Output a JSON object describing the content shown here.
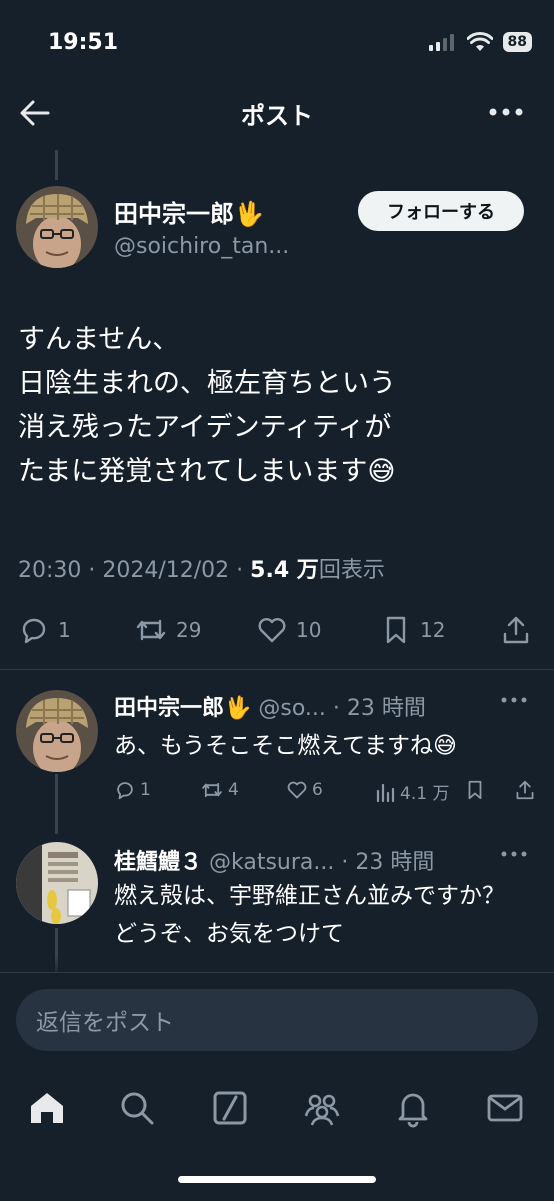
{
  "status_bar": {
    "time": "19:51",
    "battery": "88"
  },
  "header": {
    "title": "ポスト"
  },
  "post": {
    "author_name": "田中宗一郎🖖",
    "author_handle": "@soichiro_tan...",
    "follow_label": "フォローする",
    "body": "すんません、\n日陰生まれの、極左育ちという\n消え残ったアイデンティティが\nたまに発覚されてしまいます😅",
    "time": "20:30 · 2024/12/02 · ",
    "views_count": "5.4 万",
    "views_label": "回表示",
    "stats": {
      "replies": "1",
      "reposts": "29",
      "likes": "10",
      "bookmarks": "12"
    }
  },
  "replies": [
    {
      "name": "田中宗一郎🖖",
      "handle_time": " @so... · 23 時間",
      "text": "あ、もうそこそこ燃えてますね😅",
      "stats": {
        "replies": "1",
        "reposts": "4",
        "likes": "6",
        "views": "4.1 万"
      }
    },
    {
      "name": "桂鱈鱧３",
      "handle_time": " @katsura... · 23 時間",
      "text": "燃え殻は、宇野維正さん並みですか？\nどうぞ、お気をつけて"
    }
  ],
  "reply_input": {
    "placeholder": "返信をポスト"
  },
  "colors": {
    "background": "#15202b",
    "muted": "#8b98a5",
    "follow_bg": "#eff3f4"
  }
}
